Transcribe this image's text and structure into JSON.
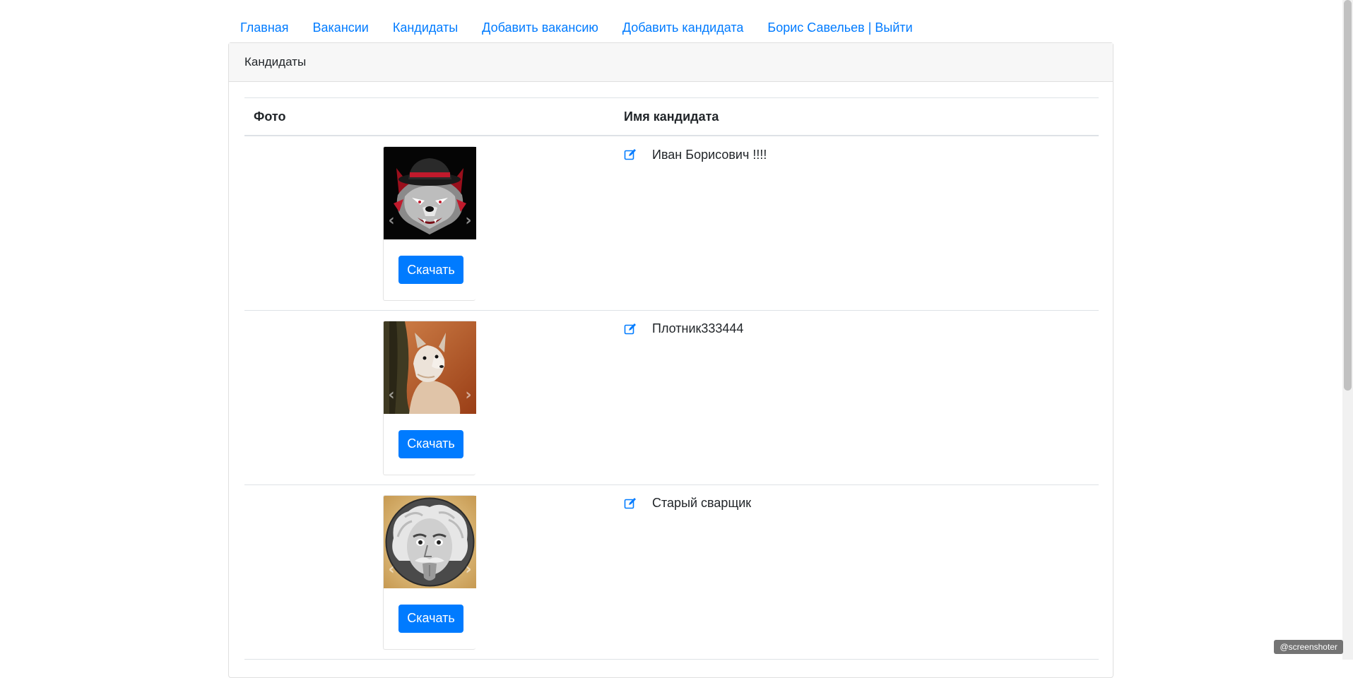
{
  "nav": {
    "items": [
      {
        "label": "Главная"
      },
      {
        "label": "Вакансии"
      },
      {
        "label": "Кандидаты"
      },
      {
        "label": "Добавить вакансию"
      },
      {
        "label": "Добавить кандидата"
      },
      {
        "label": "Борис Савельев | Выйти"
      }
    ]
  },
  "card": {
    "header": "Кандидаты",
    "table": {
      "columns": [
        "Фото",
        "Имя кандидата"
      ],
      "rows": [
        {
          "name": "Иван Борисович !!!!",
          "download_label": "Скачать",
          "photo": "wolf-mascot"
        },
        {
          "name": "Плотник333444",
          "download_label": "Скачать",
          "photo": "fox"
        },
        {
          "name": "Старый сварщик",
          "download_label": "Скачать",
          "photo": "einstein-portrait"
        }
      ]
    }
  },
  "icons": {
    "edit": "edit-icon",
    "prev": "chevron-left-icon",
    "next": "chevron-right-icon"
  },
  "colors": {
    "link": "#007bff",
    "button": "#007bff",
    "header_bg": "#f7f7f7"
  },
  "watermark": "@screenshoter"
}
